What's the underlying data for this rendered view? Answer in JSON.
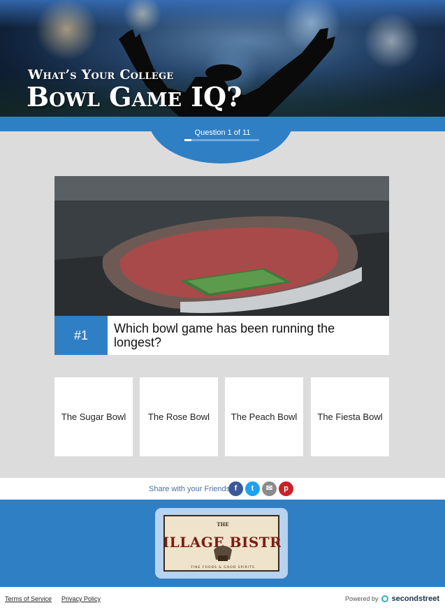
{
  "header": {
    "title_small": "What’s Your College",
    "title_big": "Bowl Game IQ?"
  },
  "progress": {
    "label": "Question 1 of 11",
    "fraction": 0.09
  },
  "question": {
    "number": "#1",
    "text": "Which bowl game has been running the longest?"
  },
  "answers": [
    {
      "label": "The Sugar Bowl"
    },
    {
      "label": "The Rose Bowl"
    },
    {
      "label": "The Peach Bowl"
    },
    {
      "label": "The Fiesta Bowl"
    }
  ],
  "share": {
    "label": "Share with your Friends!",
    "icons": [
      "facebook-icon",
      "twitter-icon",
      "email-icon",
      "pinterest-icon"
    ]
  },
  "sponsor": {
    "logo_top": "THE",
    "logo_name": "VILLAGE BISTRO",
    "logo_tagline": "FINE FOODS & GOOD SPIRITS"
  },
  "footer": {
    "terms": "Terms of Service",
    "privacy": "Privacy Policy",
    "powered_by": "Powered by",
    "brand": "secondstreet"
  },
  "colors": {
    "accent": "#2f7fc5",
    "facebook": "#3b5998",
    "twitter": "#1da1f2",
    "email": "#8a8a8a",
    "pinterest": "#cb2027"
  }
}
